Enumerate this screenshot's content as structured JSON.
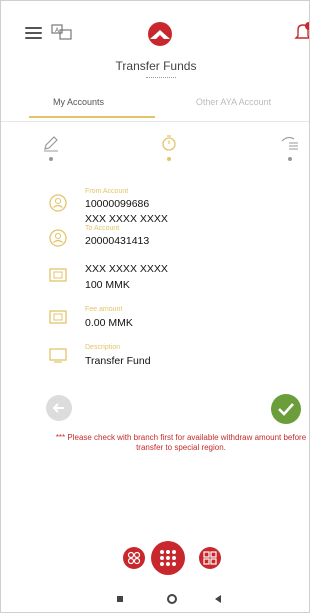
{
  "header": {
    "title": "Transfer Funds"
  },
  "tabs": [
    {
      "label": "My Accounts",
      "active": true
    },
    {
      "label": "Other AYA Account",
      "active": false
    }
  ],
  "steps": [
    {
      "icon": "pencil-icon",
      "active": false
    },
    {
      "icon": "clock-icon",
      "active": true
    },
    {
      "icon": "list-check-icon",
      "active": false
    }
  ],
  "details": {
    "from_label": "From Account",
    "from_account": "10000099686",
    "from_name": "XXX XXXX XXXX",
    "to_label": "To Account",
    "to_account": "20000431413",
    "to_name": "XXX XXXX XXXX",
    "amount": "100 MMK",
    "fee_label": "Fee amount",
    "fee_amount": "0.00 MMK",
    "desc_label": "Description",
    "description": "Transfer Fund"
  },
  "notice": "*** Please check with branch first for available withdraw amount before transfer to special region.",
  "colors": {
    "accent": "#e3c46a",
    "brand": "#c8282d",
    "confirm": "#6b9e3a",
    "warning": "#c52b2b"
  }
}
